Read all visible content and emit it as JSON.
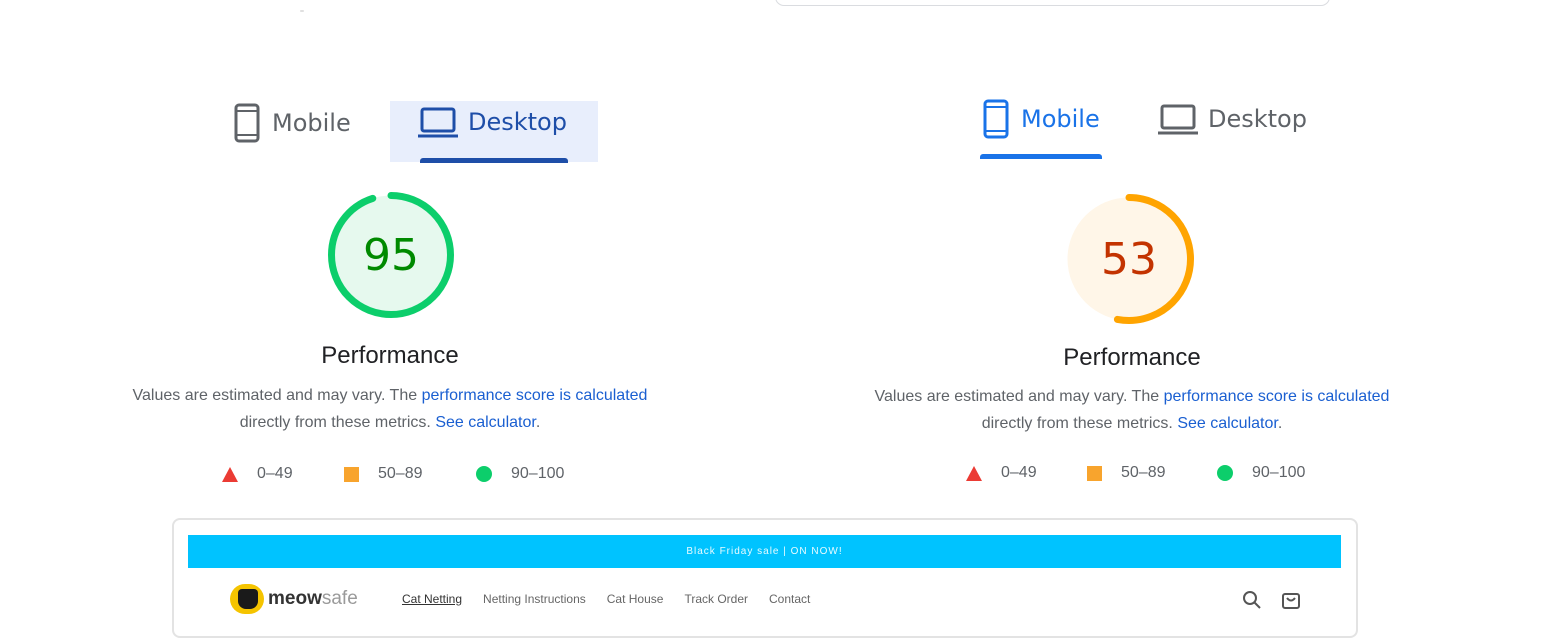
{
  "left_panel": {
    "tabs": {
      "mobile": "Mobile",
      "desktop": "Desktop",
      "active": "desktop"
    },
    "score": 95,
    "score_color": "#0cce6b",
    "score_text_color": "#008a00",
    "title": "Performance",
    "description": {
      "prefix": "Values are estimated and may vary. The ",
      "link1": "performance score is calculated",
      "middle": "directly from these metrics.",
      "link2": "See calculator",
      "suffix": "."
    },
    "legend": {
      "fail": "0–49",
      "average": "50–89",
      "pass": "90–100"
    }
  },
  "right_panel": {
    "tabs": {
      "mobile": "Mobile",
      "desktop": "Desktop",
      "active": "mobile"
    },
    "score": 53,
    "score_color": "#ffa400",
    "score_text_color": "#c33300",
    "title": "Performance",
    "description": {
      "prefix": "Values are estimated and may vary. The ",
      "link1": "performance score is calculated",
      "middle": "directly from these metrics.",
      "link2": "See calculator",
      "suffix": "."
    },
    "legend": {
      "fail": "0–49",
      "average": "50–89",
      "pass": "90–100"
    }
  },
  "colors": {
    "fail": "#eb3b34",
    "average": "#f8a42d",
    "pass": "#0cce6b",
    "link": "#1a5fd1",
    "tab_active": "#1a73e8"
  },
  "preview": {
    "banner_text": "Black Friday sale | ON NOW!",
    "logo_brand": "meow",
    "logo_suffix": "safe",
    "nav": [
      "Cat Netting",
      "Netting Instructions",
      "Cat House",
      "Track Order",
      "Contact"
    ],
    "icons": [
      "search-icon",
      "cart-icon"
    ]
  }
}
